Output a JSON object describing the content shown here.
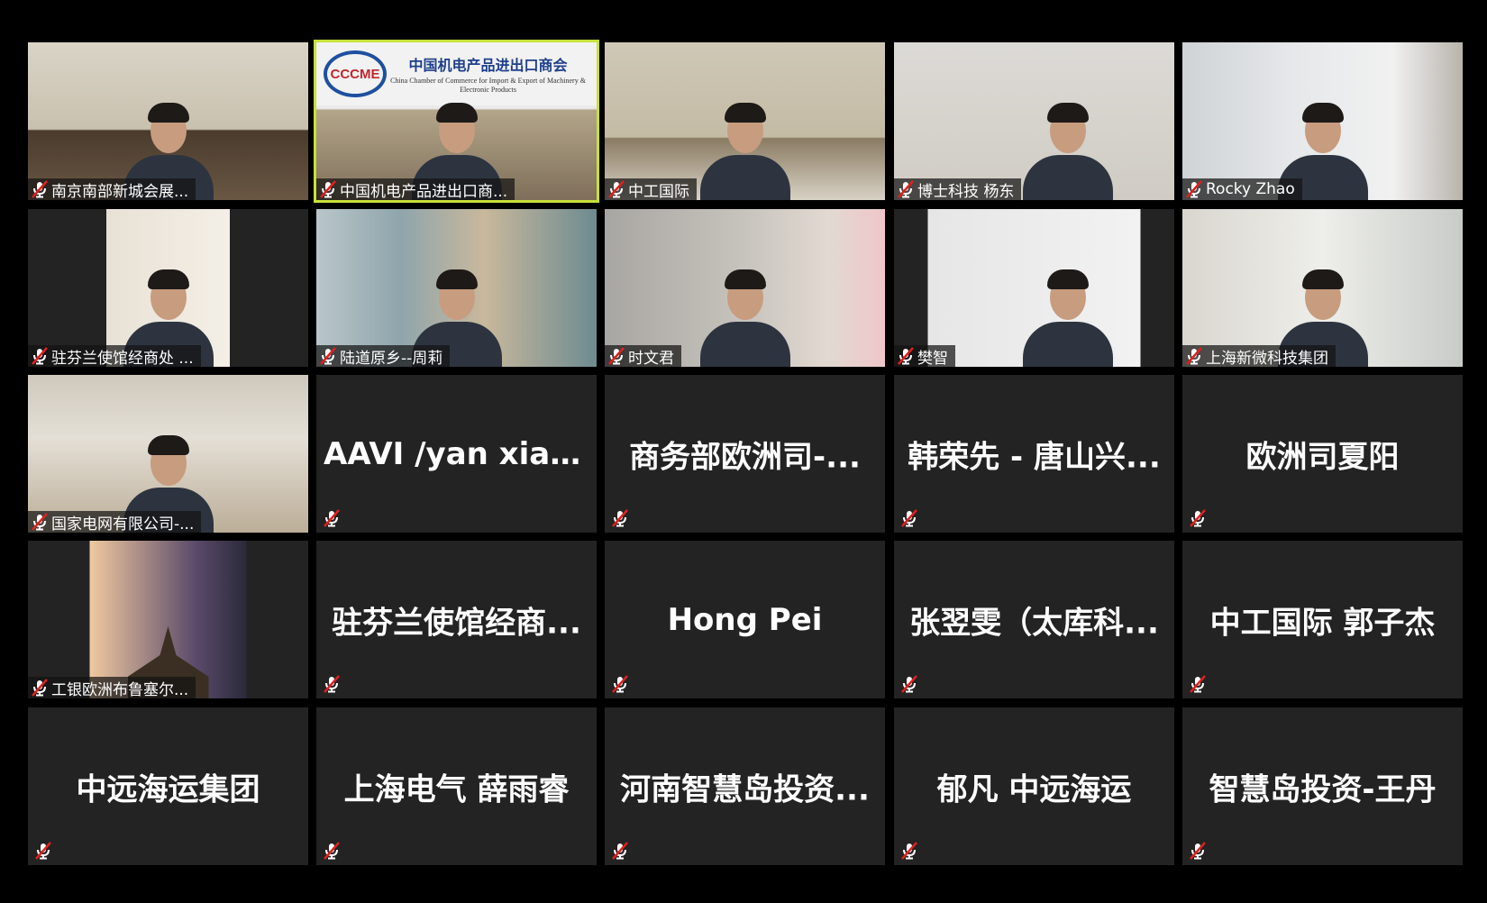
{
  "tiles": [
    {
      "name": "南京南部新城会展...",
      "video": true
    },
    {
      "name": "中国机电产品进出口商...",
      "video": true,
      "speaking": true,
      "banner_title": "中国机电产品进出口商会",
      "banner_sub": "China Chamber of Commerce for Import & Export of Machinery & Electronic Products",
      "logo": "CCCME"
    },
    {
      "name": "中工国际",
      "video": true
    },
    {
      "name": "博士科技 杨东",
      "video": true
    },
    {
      "name": "Rocky Zhao",
      "video": true
    },
    {
      "name": "驻芬兰使馆经商处 ...",
      "video": true
    },
    {
      "name": "陆道原乡--周莉",
      "video": true
    },
    {
      "name": "时文君",
      "video": true
    },
    {
      "name": "樊智",
      "video": true
    },
    {
      "name": "上海新微科技集团",
      "video": true
    },
    {
      "name": "国家电网有限公司-...",
      "video": true
    },
    {
      "name": "AAVI /yan xianj...",
      "video": false
    },
    {
      "name": "商务部欧洲司-...",
      "video": false
    },
    {
      "name": "韩荣先 - 唐山兴...",
      "video": false
    },
    {
      "name": "欧洲司夏阳",
      "video": false
    },
    {
      "name": "工银欧洲布鲁塞尔...",
      "video": true
    },
    {
      "name": "驻芬兰使馆经商...",
      "video": false
    },
    {
      "name": "Hong Pei",
      "video": false
    },
    {
      "name": "张翌雯（太库科...",
      "video": false
    },
    {
      "name": "中工国际 郭子杰",
      "video": false
    },
    {
      "name": "中远海运集团",
      "video": false
    },
    {
      "name": "上海电气 薛雨睿",
      "video": false
    },
    {
      "name": "河南智慧岛投资...",
      "video": false
    },
    {
      "name": "郁凡 中远海运",
      "video": false
    },
    {
      "name": "智慧岛投资-王丹",
      "video": false
    }
  ],
  "colors": {
    "background": "#000000",
    "tile": "#232323",
    "speaking": "#c8e03a",
    "muted": "#e02020"
  },
  "icons": {
    "mic": "muted-mic-icon"
  }
}
